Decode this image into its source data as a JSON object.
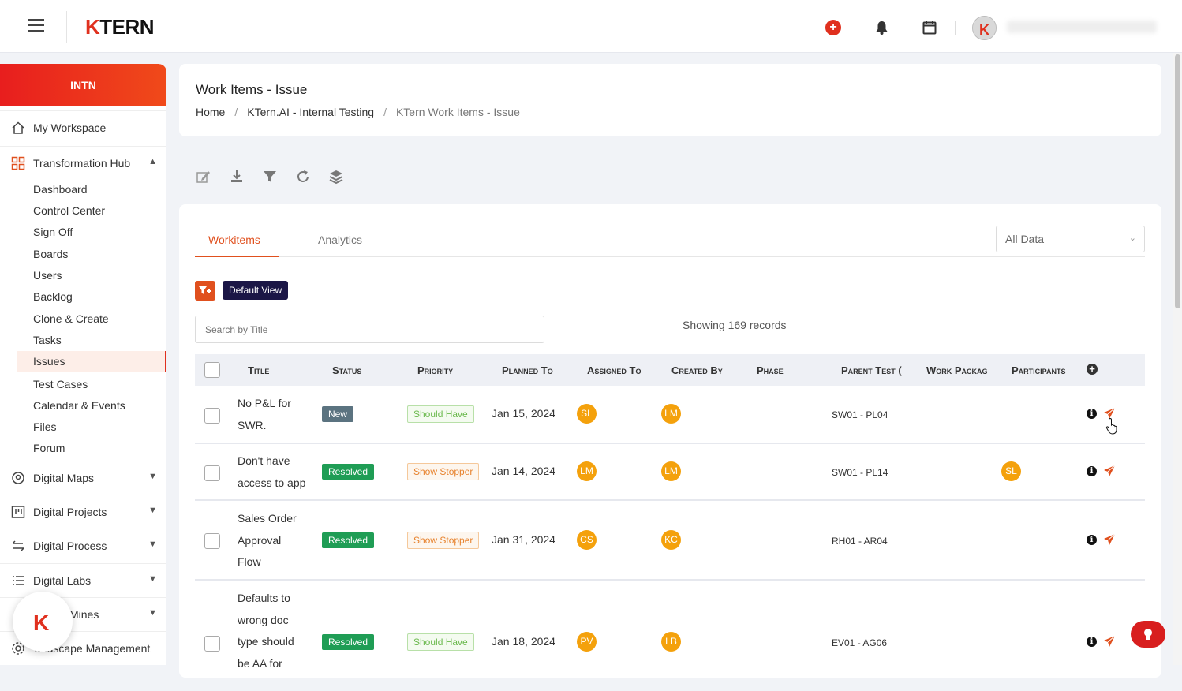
{
  "brand": {
    "logo_k": "K",
    "logo_rest": "TERN"
  },
  "org": "INTN",
  "sidebar": {
    "workspace": "My Workspace",
    "hub": "Transformation Hub",
    "sub_items": [
      "Dashboard",
      "Control Center",
      "Sign Off",
      "Boards",
      "Users",
      "Backlog",
      "Clone & Create",
      "Tasks",
      "Issues",
      "Test Cases",
      "Calendar & Events",
      "Files",
      "Forum"
    ],
    "active_item": "Issues",
    "groups": [
      "Digital Maps",
      "Digital Projects",
      "Digital Process",
      "Digital Labs",
      "Mines",
      "andscape Management"
    ]
  },
  "header": {
    "title": "Work Items - Issue",
    "breadcrumb": [
      "Home",
      "KTern.AI - Internal Testing",
      "KTern Work Items - Issue"
    ]
  },
  "tabs": {
    "workitems": "Workitems",
    "analytics": "Analytics"
  },
  "data_scope": "All Data",
  "default_view": "Default View",
  "search": {
    "placeholder": "Search by Title"
  },
  "showing": "Showing 169 records",
  "columns": [
    "Title",
    "Status",
    "Priority",
    "Planned To",
    "Assigned To",
    "Created By",
    "Phase",
    "Parent Test (",
    "Work Packag",
    "Participants"
  ],
  "rows": [
    {
      "title_lines": [
        "No P&L for",
        "SWR."
      ],
      "status": "New",
      "priority": "Should Have",
      "planned": "Jan 15, 2024",
      "assigned": "SL",
      "created": "LM",
      "parent": "SW01 - PL04",
      "participant": ""
    },
    {
      "title_lines": [
        "Don't have",
        "access to app"
      ],
      "status": "Resolved",
      "priority": "Show Stopper",
      "planned": "Jan 14, 2024",
      "assigned": "LM",
      "created": "LM",
      "parent": "SW01 - PL14",
      "participant": "SL"
    },
    {
      "title_lines": [
        "Sales Order",
        "Approval",
        "Flow"
      ],
      "status": "Resolved",
      "priority": "Show Stopper",
      "planned": "Jan 31, 2024",
      "assigned": "CS",
      "created": "KC",
      "parent": "RH01 - AR04",
      "participant": ""
    },
    {
      "title_lines": [
        "Defaults to",
        "wrong doc",
        "type should",
        "be AA for"
      ],
      "status": "Resolved",
      "priority": "Should Have",
      "planned": "Jan 18, 2024",
      "assigned": "PV",
      "created": "LB",
      "parent": "EV01 - AG06",
      "participant": ""
    }
  ],
  "colors": {
    "accent": "#e0501e",
    "brand_red": "#e0301e",
    "avatar": "#f4a10c",
    "resolved": "#1f9d55",
    "new": "#5b7380"
  }
}
